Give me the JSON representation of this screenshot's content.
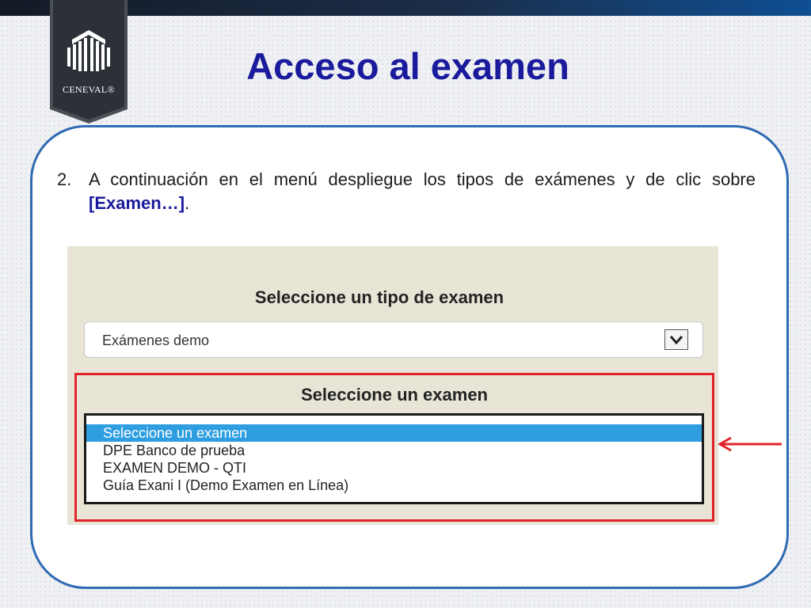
{
  "slide": {
    "title": "Acceso al examen",
    "logo_text": "CENEVAL®",
    "instruction": {
      "number": "2.",
      "text": "A continuación en el menú despliegue los tipos de exámenes y de clic sobre ",
      "highlight": "[Examen…]",
      "end": "."
    }
  },
  "form": {
    "type_label": "Seleccione un tipo de examen",
    "type_selected": "Exámenes demo",
    "exam_label": "Seleccione un examen",
    "exam_options": [
      "Seleccione un examen",
      "DPE Banco de prueba",
      "EXAMEN DEMO - QTI",
      "Guía Exani I (Demo Examen en Línea)"
    ],
    "exam_selected_index": 0
  },
  "colors": {
    "title": "#1a1a9c",
    "frame_border": "#2f6bb2",
    "highlight_box": "#e0242a",
    "selected_option": "#2e9ee0"
  },
  "icons": {
    "logo": "ceneval-logo-icon",
    "dropdown": "chevron-down-icon",
    "pointer": "left-arrow-icon"
  }
}
